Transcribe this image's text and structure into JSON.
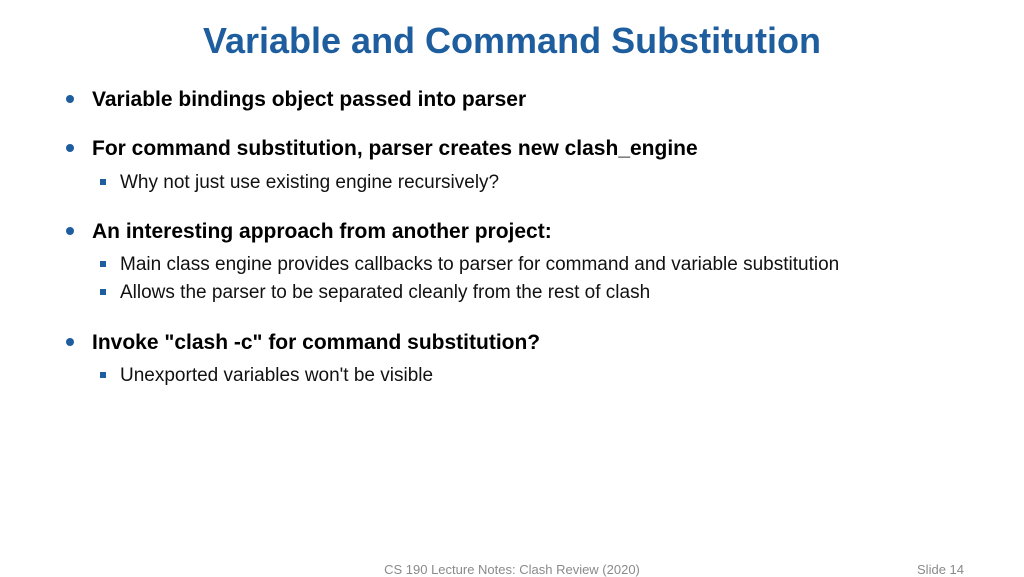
{
  "title": "Variable and Command Substitution",
  "bullets": [
    {
      "head": "Variable bindings object passed into parser",
      "subs": []
    },
    {
      "head": "For command substitution, parser creates new clash_engine",
      "subs": [
        "Why not just use existing engine recursively?"
      ]
    },
    {
      "head": "An interesting approach from another project:",
      "subs": [
        "Main class engine provides callbacks to parser for command and variable substitution",
        "Allows the parser to be separated cleanly from the rest of clash"
      ]
    },
    {
      "head": "Invoke \"clash -c\" for command substitution?",
      "subs": [
        "Unexported variables won't be visible"
      ]
    }
  ],
  "footer": {
    "left": "CS 190 Lecture Notes: Clash Review (2020)",
    "right": "Slide 14"
  }
}
